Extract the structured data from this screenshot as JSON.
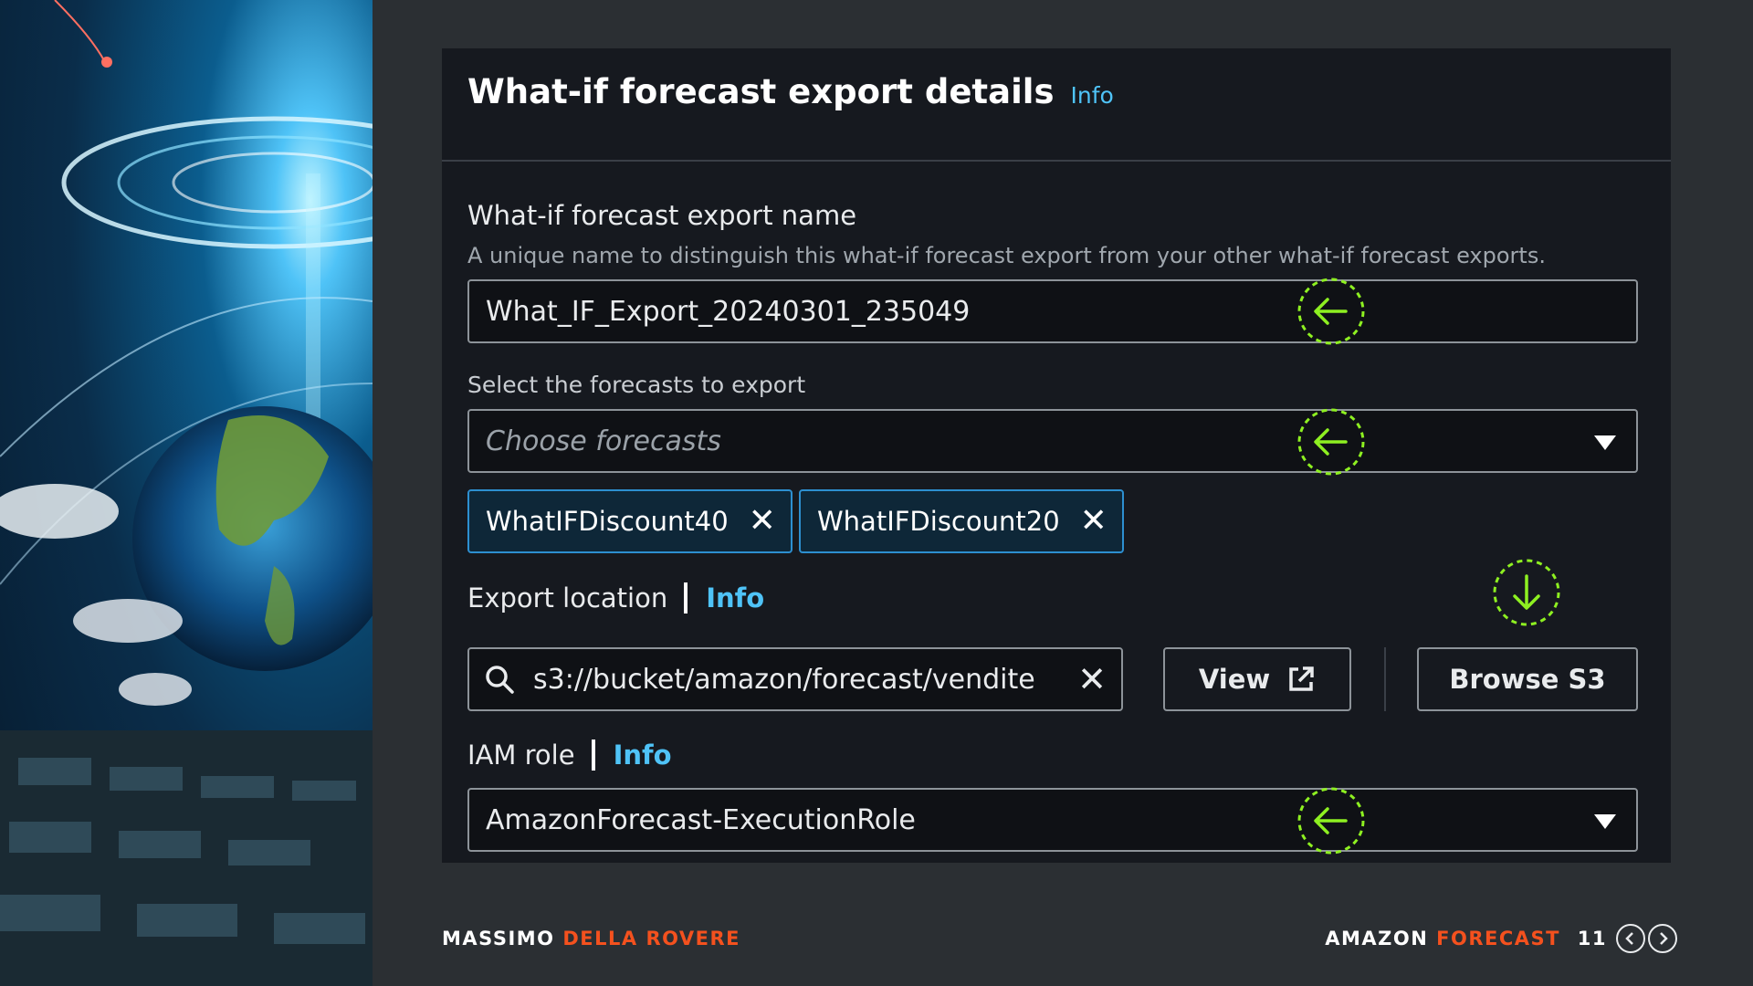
{
  "panel": {
    "title": "What-if forecast export details",
    "title_info": "Info"
  },
  "export_name": {
    "label": "What-if forecast export name",
    "description": "A unique name to distinguish this what-if forecast export from your other what-if forecast exports.",
    "value": "What_IF_Export_20240301_235049"
  },
  "forecasts": {
    "label": "Select the forecasts to export",
    "placeholder": "Choose forecasts",
    "tokens": [
      "WhatIFDiscount40",
      "WhatIFDiscount20"
    ]
  },
  "export_location": {
    "label": "Export location",
    "info": "Info",
    "value": "s3://bucket/amazon/forecast/vendite",
    "view_button": "View",
    "browse_button": "Browse S3"
  },
  "iam_role": {
    "label": "IAM role",
    "info": "Info",
    "value": "AmazonForecast-ExecutionRole"
  },
  "footer": {
    "author_first": "MASSIMO",
    "author_last": "DELLA ROVERE",
    "product_first": "AMAZON",
    "product_second": "FORECAST",
    "page_number": "11"
  },
  "colors": {
    "accent_link": "#4fc3f7",
    "annotation": "#8ef021",
    "footer_accent": "#f4511e",
    "token_border": "#2d8fd0"
  },
  "icons": {
    "annotation_left": "arrow-left-dashed-circle-icon",
    "annotation_down": "arrow-down-dashed-circle-icon",
    "search": "search-icon",
    "external": "external-link-icon",
    "remove": "close-icon",
    "dropdown": "caret-down-icon"
  }
}
